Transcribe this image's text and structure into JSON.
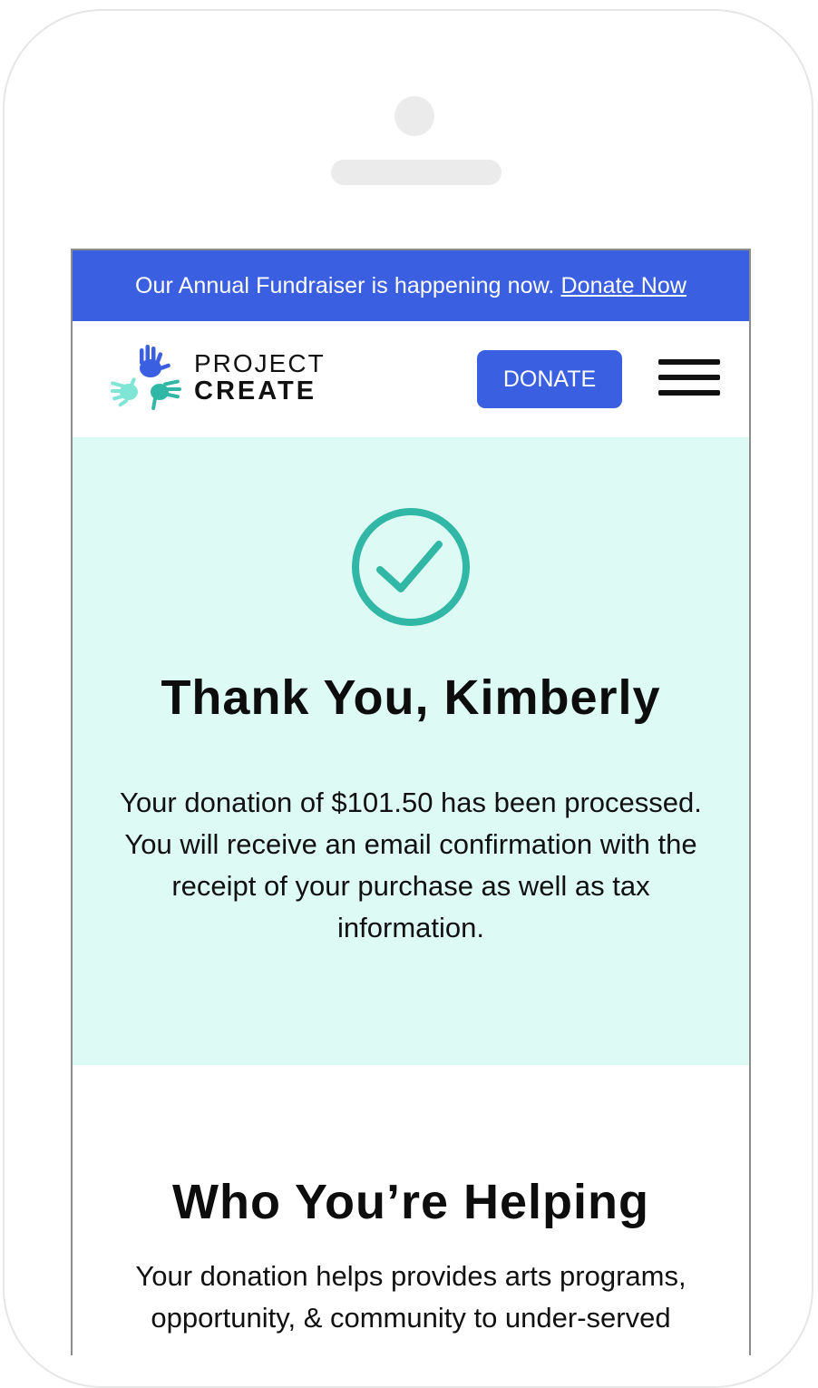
{
  "banner": {
    "text": "Our Annual Fundraiser is happening now.",
    "link": "Donate Now"
  },
  "header": {
    "logo_line1": "PROJECT",
    "logo_line2": "CREATE",
    "donate_label": "DONATE"
  },
  "confirmation": {
    "title": "Thank You, Kimberly",
    "message": "Your donation of $101.50 has been processed. You will receive an email confirmation with the receipt of your purchase as well as tax information."
  },
  "helping": {
    "title": "Who You’re Helping",
    "text": "Your donation helps provides arts programs, opportunity, & community to under-served"
  },
  "colors": {
    "brand_blue": "#3a5fe0",
    "hero_bg": "#defaf4",
    "check_teal": "#30b7a5"
  }
}
